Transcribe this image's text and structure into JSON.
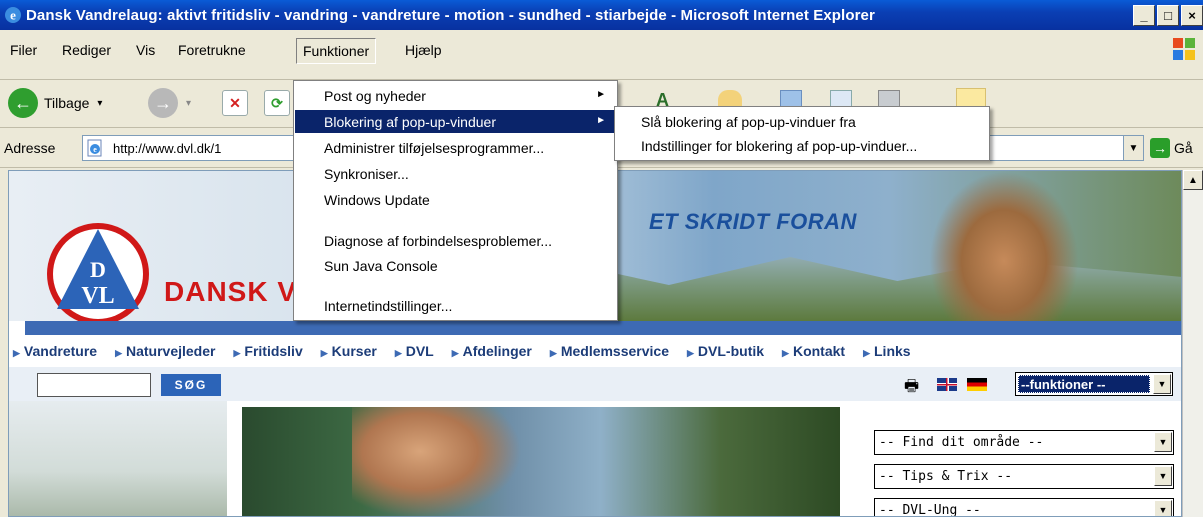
{
  "window": {
    "title": "Dansk Vandrelaug: aktivt fritidsliv - vandring - vandreture - motion - sundhed - stiarbejde - Microsoft Internet Explorer",
    "minimize": "_",
    "maximize": "□",
    "close": "×"
  },
  "menubar": {
    "items": [
      "Filer",
      "Rediger",
      "Vis",
      "Foretrukne",
      "Funktioner",
      "Hjælp"
    ]
  },
  "toolbar": {
    "back_label": "Tilbage",
    "back_arrow": "▾",
    "forward_arrow": "▾"
  },
  "addressbar": {
    "label": "Adresse",
    "url": "http://www.dvl.dk/1",
    "go_label": "Gå"
  },
  "funktioner_menu": {
    "items": [
      {
        "label": "Post og nyheder",
        "submenu": "►"
      },
      {
        "label": "Blokering af pop-up-vinduer",
        "submenu": "►"
      },
      {
        "label": "Administrer tilføjelsesprogrammer..."
      },
      {
        "label": "Synkroniser..."
      },
      {
        "label": "Windows Update"
      },
      {
        "label": "Diagnose af forbindelsesproblemer..."
      },
      {
        "label": "Sun Java Console"
      },
      {
        "label": "Internetindstillinger..."
      }
    ]
  },
  "popup_submenu": {
    "items": [
      "Slå blokering af pop-up-vinduer fra",
      "Indstillinger for blokering af pop-up-vinduer..."
    ]
  },
  "page": {
    "slogan": "ET SKRIDT FORAN",
    "brand": "DANSK V",
    "logo_text_top": "D",
    "logo_text_bottom": "VL",
    "nav": [
      "Vandreture",
      "Naturvejleder",
      "Fritidsliv",
      "Kurser",
      "DVL",
      "Afdelinger",
      "Medlemsservice",
      "DVL-butik",
      "Kontakt",
      "Links"
    ],
    "search_button": "SØG",
    "funktioner_select": "--funktioner --",
    "right_selects": [
      "-- Find dit område --",
      "-- Tips & Trix --",
      "-- DVL-Ung --"
    ]
  },
  "colors": {
    "title_bar": "#0a3fb4",
    "menu_highlight": "#0a246a",
    "brand_red": "#d01818",
    "nav_blue": "#1c3c78",
    "band_blue": "#3d6ab4"
  }
}
